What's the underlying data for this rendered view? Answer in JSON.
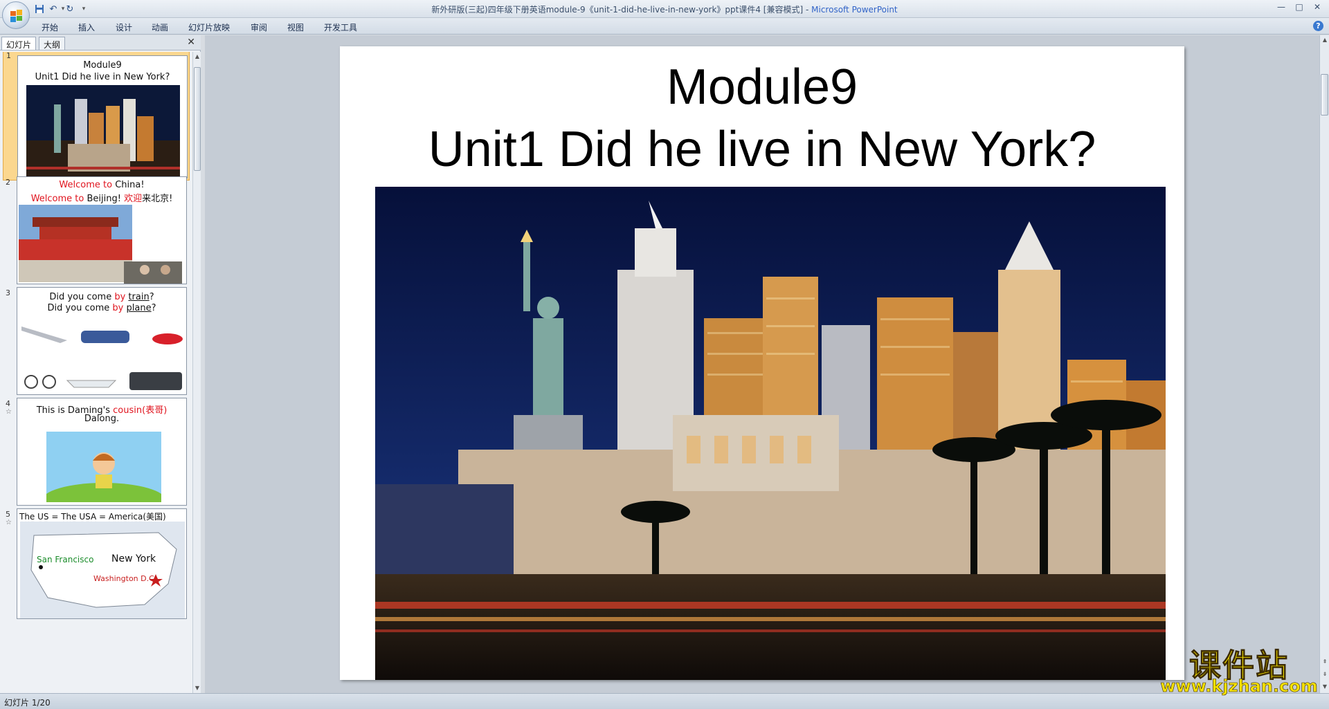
{
  "window": {
    "title": "新外研版(三起)四年级下册英语module-9《unit-1-did-he-live-in-new-york》ppt课件4 [兼容模式] - ",
    "app_name": "Microsoft PowerPoint",
    "minimize": "—",
    "maximize": "□",
    "close": "✕"
  },
  "quick_access": {
    "save_icon": "save-icon",
    "undo_icon": "undo-icon",
    "redo_icon": "redo-icon",
    "customize_icon": "customize-icon"
  },
  "ribbon": {
    "tabs": [
      "开始",
      "插入",
      "设计",
      "动画",
      "幻灯片放映",
      "审阅",
      "视图",
      "开发工具"
    ],
    "help": "?"
  },
  "left_panel": {
    "tabs": [
      "幻灯片",
      "大纲"
    ],
    "close": "✕",
    "slides": [
      {
        "number": "1",
        "line1": "Module9",
        "line2": "Unit1 Did he live in New York?"
      },
      {
        "number": "2",
        "line1_red": "Welcome to",
        "line1": " China!",
        "line2_red": "Welcome to",
        "line2": " Beijing! ",
        "line2_cn_red": "欢迎",
        "line2_cn": "来北京!"
      },
      {
        "number": "3",
        "q1_a": "Did you come ",
        "q1_by": "by",
        "q1_word": "train",
        "q1_end": "?",
        "q2_a": "Did you come ",
        "q2_by": "by",
        "q2_word": "plane",
        "q2_end": "?"
      },
      {
        "number": "4",
        "line1_a": "This is Daming's ",
        "line1_red": "cousin(表哥)",
        "line2": "Dalong."
      },
      {
        "number": "5",
        "line1": "The US  = The USA = America(美国)",
        "city1": "San Francisco",
        "city2": "New York",
        "city3": "Washington D.C."
      }
    ]
  },
  "slide": {
    "title_line1": "Module9",
    "title_line2": "Unit1 Did he live in New York?"
  },
  "status": {
    "text": "幻灯片 1/20"
  },
  "watermark": {
    "cn": "课件站",
    "url": "www.kjzhan.com"
  },
  "colors": {
    "accent_red": "#e0141e",
    "selection": "#fbd78f",
    "watermark_yellow": "#f5e100"
  }
}
